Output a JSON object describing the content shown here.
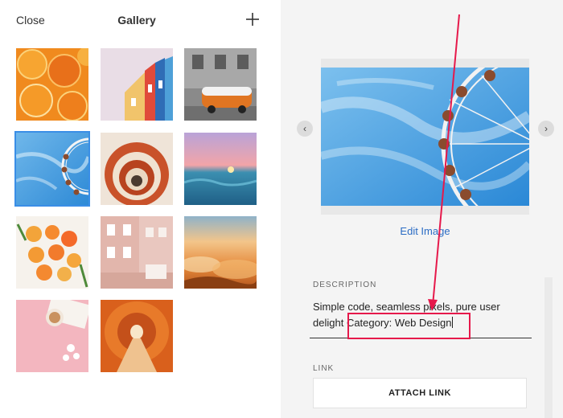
{
  "left_panel": {
    "close_label": "Close",
    "title": "Gallery",
    "add_icon": "plus-icon",
    "thumbnails": [
      {
        "name": "oranges-photo"
      },
      {
        "name": "colorful-houses-photo"
      },
      {
        "name": "orange-van-photo"
      },
      {
        "name": "ferris-wheel-photo",
        "selected": true
      },
      {
        "name": "spiral-staircase-photo"
      },
      {
        "name": "ocean-sunset-photo"
      },
      {
        "name": "citrus-slices-photo"
      },
      {
        "name": "pink-building-photo"
      },
      {
        "name": "cloudy-sunset-photo"
      },
      {
        "name": "pink-coffee-photo"
      },
      {
        "name": "orange-tunnel-photo"
      }
    ]
  },
  "right_panel": {
    "prev_icon": "chevron-left-icon",
    "next_icon": "chevron-right-icon",
    "edit_image_label": "Edit Image",
    "description_label": "DESCRIPTION",
    "description_line1": "Simple code, seamless pixels, pure user",
    "description_line2_prefix": "delight",
    "description_line2_category": "Category: Web Design",
    "link_label": "LINK",
    "attach_link_label": "ATTACH LINK"
  },
  "colors": {
    "accent_link": "#2b6cc4",
    "selection_outline": "#3a8ee6",
    "annotation": "#e6194b",
    "right_panel_bg": "#f4f4f4"
  }
}
